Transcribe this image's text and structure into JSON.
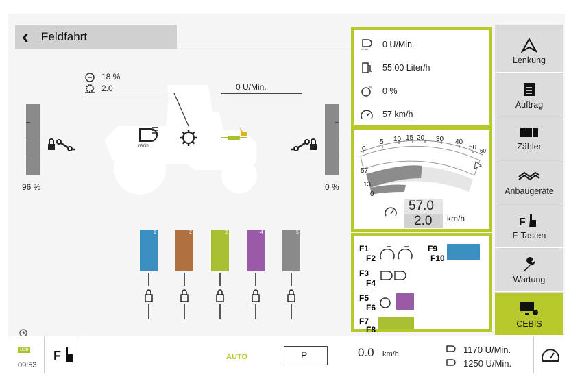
{
  "header": {
    "title": "Feldfahrt"
  },
  "tractor": {
    "top_pct": "18 %",
    "top_val": "2.0",
    "pto_speed": "0 U/Min.",
    "left_pct": "96 %",
    "right_pct": "0 %"
  },
  "stats": [
    {
      "icon": "engine-speed-icon",
      "value": "0 U/Min."
    },
    {
      "icon": "fuel-icon",
      "value": "55.00 Liter/h"
    },
    {
      "icon": "slip-icon",
      "value": "0 %"
    },
    {
      "icon": "speedometer-icon",
      "value": "57 km/h"
    }
  ],
  "speed_gauge": {
    "scale_labels": [
      "0",
      "5",
      "10",
      "15",
      "20",
      "30",
      "40",
      "50",
      "60"
    ],
    "side_labels": [
      "57",
      "13",
      "0"
    ],
    "speed_value": "57.0",
    "target_value": "2.0",
    "unit": "km/h"
  },
  "fkeys": {
    "f1": "F1",
    "f2": "F2",
    "f3": "F3",
    "f4": "F4",
    "f5": "F5",
    "f6": "F6",
    "f7": "F7",
    "f8": "F8",
    "f9": "F9",
    "f10": "F10"
  },
  "sidebar": {
    "items": [
      {
        "label": "Lenkung",
        "icon": "steering-icon"
      },
      {
        "label": "Auftrag",
        "icon": "clipboard-icon"
      },
      {
        "label": "Zähler",
        "icon": "counter-icon"
      },
      {
        "label": "Anbaugeräte",
        "icon": "implement-icon"
      },
      {
        "label": "F-Tasten",
        "icon": "hand-f-icon"
      },
      {
        "label": "Wartung",
        "icon": "wrench-icon"
      },
      {
        "label": "CEBIS",
        "icon": "monitor-gear-icon"
      }
    ]
  },
  "valves": [
    {
      "num": "1",
      "color": "#3a8fc0"
    },
    {
      "num": "2",
      "color": "#b07040"
    },
    {
      "num": "3",
      "color": "#a8c030"
    },
    {
      "num": "4",
      "color": "#9a5aa8"
    },
    {
      "num": "5",
      "color": "#8a8a8a"
    }
  ],
  "bottom": {
    "usb": "USB",
    "time": "09:53",
    "auto": "AUTO",
    "park": "P",
    "speed": "0.0",
    "speed_unit": "km/h",
    "rpm1": "1170 U/Min.",
    "rpm2": "1250 U/Min."
  },
  "colors": {
    "accent": "#b7c92a",
    "sidebar": "#dcdcdc"
  }
}
